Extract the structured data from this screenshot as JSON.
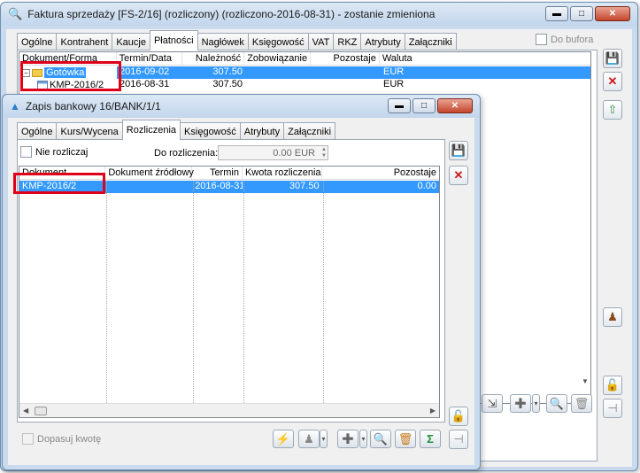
{
  "back_window": {
    "title": "Faktura sprzedaży [FS-2/16] (rozliczony) (rozliczono-2016-08-31) - zostanie zmieniona",
    "tabs": [
      "Ogólne",
      "Kontrahent",
      "Kaucje",
      "Płatności",
      "Nagłówek",
      "Księgowość",
      "VAT",
      "RKZ",
      "Atrybuty",
      "Załączniki"
    ],
    "active_tab": "Płatności",
    "do_bufora_label": "Do bufora",
    "grid": {
      "columns": [
        "Dokument/Forma",
        "Termin/Data",
        "Należność",
        "Zobowiązanie",
        "Pozostaje",
        "Waluta"
      ],
      "rows": [
        {
          "doc": "Gotówka",
          "date": "2016-09-02",
          "amount": "307.50",
          "liability": "",
          "remaining": "",
          "currency": "EUR",
          "selected": true
        },
        {
          "doc": "KMP-2016/2",
          "date": "2016-08-31",
          "amount": "307.50",
          "liability": "",
          "remaining": "",
          "currency": "EUR",
          "selected": false
        }
      ]
    }
  },
  "front_window": {
    "title": "Zapis bankowy 16/BANK/1/1",
    "tabs": [
      "Ogólne",
      "Kurs/Wycena",
      "Rozliczenia",
      "Księgowość",
      "Atrybuty",
      "Załączniki"
    ],
    "active_tab": "Rozliczenia",
    "nie_rozliczaj_label": "Nie rozliczaj",
    "do_rozliczenia_label": "Do rozliczenia:",
    "do_rozliczenia_value": "0.00 EUR",
    "grid": {
      "columns": [
        "Dokument",
        "Dokument źródłowy",
        "Termin",
        "Kwota rozliczenia",
        "Pozostaje"
      ],
      "rows": [
        {
          "doc": "KMP-2016/2",
          "source": "",
          "date": "2016-08-31",
          "amount": "307.50",
          "remaining": "0.00",
          "selected": true
        }
      ]
    },
    "dopasuj_label": "Dopasuj kwotę"
  },
  "colors": {
    "selection": "#3399ff",
    "highlight": "#e0001a",
    "window_frame": "#c9daee"
  }
}
